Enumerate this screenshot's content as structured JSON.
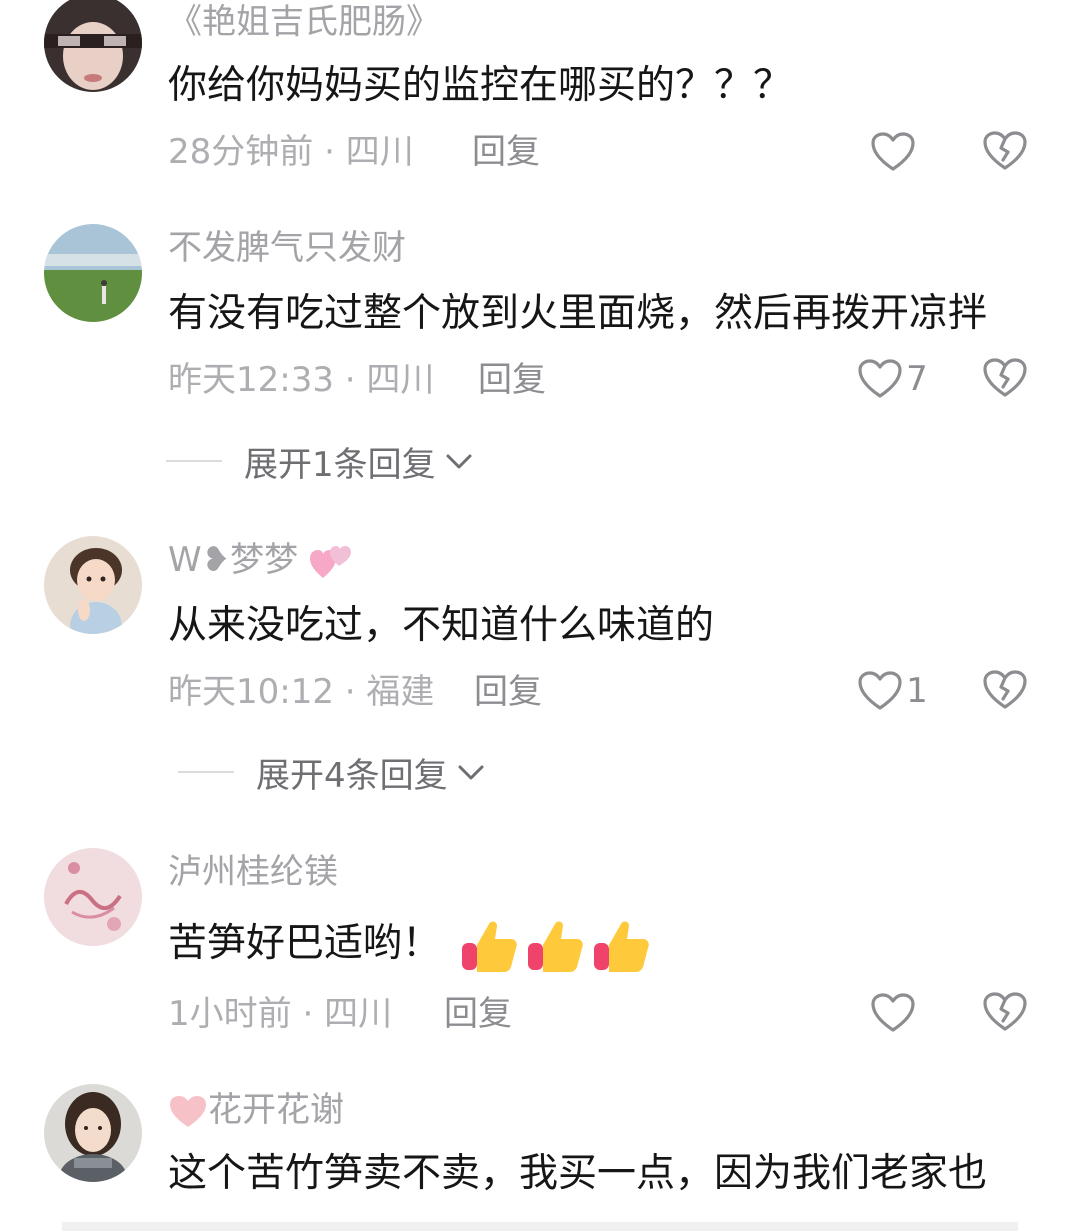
{
  "comments": [
    {
      "username": "《艳姐吉氏肥肠》",
      "text": "你给你妈妈买的监控在哪买的？？？",
      "time": "28分钟前",
      "location": "四川",
      "reply_label": "回复",
      "likes": ""
    },
    {
      "username": "不发脾气只发财",
      "text": "有没有吃过整个放到火里面烧，然后再拨开凉拌",
      "time": "昨天12:33",
      "location": "四川",
      "reply_label": "回复",
      "likes": "7",
      "expand_label": "展开1条回复"
    },
    {
      "username": "W❥梦梦",
      "text": "从来没吃过，不知道什么味道的",
      "time": "昨天10:12",
      "location": "福建",
      "reply_label": "回复",
      "likes": "1",
      "expand_label": "展开4条回复"
    },
    {
      "username": "泸州桂纶镁",
      "text": "苦笋好巴适哟！",
      "time": "1小时前",
      "location": "四川",
      "reply_label": "回复",
      "likes": ""
    },
    {
      "username": "花开花谢",
      "text": "这个苦竹笋卖不卖，我买一点，因为我们老家也"
    }
  ],
  "meta_separator": " · ",
  "icons": {
    "like": "heart-outline-icon",
    "dislike": "broken-heart-icon",
    "expand": "chevron-down-icon",
    "emoji": "thumbs-up-emoji",
    "username_decoration": "sparkling-heart-emoji"
  },
  "colors": {
    "username": "#a3a3a8",
    "text": "#161616",
    "meta": "#aeaeb2",
    "icon": "#8c8c91"
  }
}
